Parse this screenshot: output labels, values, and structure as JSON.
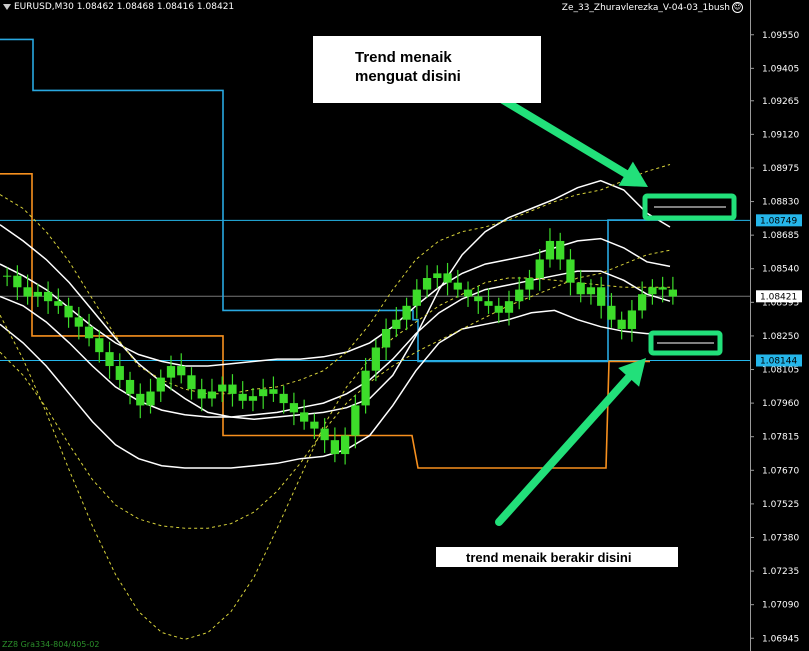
{
  "header": {
    "symbol_info": "EURUSD,M30  1.08462 1.08468 1.08416 1.08421",
    "indicator_title": "Ze_33_Zhuravlerezka_V-04-03_1bush"
  },
  "annotations": {
    "top": "Trend menaik\nmenguat disini",
    "bottom": "trend menaik berakir disini"
  },
  "footer": "ZZ8 Gra334-804/405-02",
  "chart_data": {
    "type": "line",
    "symbol": "EURUSD",
    "timeframe": "M30",
    "ylim": [
      1.0689,
      1.097
    ],
    "y_ticks": [
      "1.09550",
      "1.09405",
      "1.09265",
      "1.09120",
      "1.08975",
      "1.08830",
      "1.08685",
      "1.08540",
      "1.08395",
      "1.08250",
      "1.08105",
      "1.07960",
      "1.07815",
      "1.07670",
      "1.07525",
      "1.07380",
      "1.07235",
      "1.07090",
      "1.06945"
    ],
    "price_tags": [
      {
        "label": "1.08749",
        "value": 1.08749,
        "color": "#25b6ea"
      },
      {
        "label": "1.08421",
        "value": 1.08421,
        "color": "#ffffff"
      },
      {
        "label": "1.08144",
        "value": 1.08144,
        "color": "#25b6ea"
      }
    ],
    "hlines": [
      {
        "value": 1.08749,
        "color": "#25b6ea"
      },
      {
        "value": 1.08144,
        "color": "#25b6ea"
      },
      {
        "value": 1.08421,
        "color": "#777777"
      }
    ],
    "close_series": [
      1.0851,
      1.0846,
      1.0842,
      1.0844,
      1.084,
      1.0838,
      1.0833,
      1.0829,
      1.0824,
      1.0818,
      1.0812,
      1.0806,
      1.08,
      1.0795,
      1.0801,
      1.0807,
      1.0812,
      1.0808,
      1.0802,
      1.0798,
      1.0801,
      1.0804,
      1.08,
      1.0797,
      1.0799,
      1.0802,
      1.08,
      1.0796,
      1.0792,
      1.0788,
      1.0785,
      1.078,
      1.0774,
      1.0782,
      1.0795,
      1.081,
      1.082,
      1.0828,
      1.0832,
      1.0838,
      1.0845,
      1.085,
      1.0852,
      1.0848,
      1.0845,
      1.0842,
      1.084,
      1.0838,
      1.0835,
      1.084,
      1.0845,
      1.085,
      1.0858,
      1.0866,
      1.0858,
      1.0848,
      1.0843,
      1.0846,
      1.0838,
      1.0832,
      1.0828,
      1.0836,
      1.0843,
      1.0846,
      1.0845,
      1.0842
    ],
    "series": [
      {
        "name": "",
        "color": "#ffffff",
        "values": [
          1.0873,
          1.0866,
          1.0858,
          1.0848,
          1.0836,
          1.0824,
          1.0813,
          1.0805,
          1.0798,
          1.0792,
          1.079,
          1.0789,
          1.079,
          1.0791,
          1.0792,
          1.0794,
          1.0798,
          1.0808,
          1.0825,
          1.0845,
          1.086,
          1.087,
          1.0876,
          1.088,
          1.0884,
          1.0889,
          1.0892,
          1.0888,
          1.0878,
          1.0872
        ]
      },
      {
        "name": "",
        "color": "#ffffff",
        "values": [
          1.0856,
          1.0851,
          1.0845,
          1.0837,
          1.0829,
          1.0822,
          1.0817,
          1.0814,
          1.0812,
          1.0812,
          1.0813,
          1.0814,
          1.0815,
          1.0815,
          1.0816,
          1.0818,
          1.0822,
          1.0829,
          1.0838,
          1.0846,
          1.0852,
          1.0856,
          1.0858,
          1.086,
          1.0863,
          1.0866,
          1.0867,
          1.0863,
          1.0857,
          1.0855
        ]
      },
      {
        "name": "",
        "color": "#ffffff",
        "values": [
          1.0842,
          1.0838,
          1.0831,
          1.0822,
          1.0812,
          1.0803,
          1.0797,
          1.0793,
          1.0791,
          1.079,
          1.079,
          1.0791,
          1.0792,
          1.0794,
          1.0796,
          1.08,
          1.0806,
          1.0815,
          1.0826,
          1.0835,
          1.0841,
          1.0845,
          1.0847,
          1.0849,
          1.0851,
          1.0853,
          1.0853,
          1.0849,
          1.0843,
          1.084
        ]
      },
      {
        "name": "",
        "color": "#ffffff",
        "values": [
          1.083,
          1.0822,
          1.0812,
          1.08,
          1.0788,
          1.0778,
          1.0772,
          1.0769,
          1.0768,
          1.0768,
          1.0768,
          1.0769,
          1.077,
          1.0772,
          1.0773,
          1.0776,
          1.0782,
          1.0795,
          1.081,
          1.0822,
          1.0828,
          1.083,
          1.0832,
          1.0835,
          1.0836,
          1.0832,
          1.0829,
          1.0827,
          1.0826,
          1.0826
        ]
      },
      {
        "name": "",
        "color": "#d7d23a",
        "values": [
          1.0886,
          1.088,
          1.087,
          1.0857,
          1.0841,
          1.0825,
          1.0812,
          1.0806,
          1.0802,
          1.08,
          1.08,
          1.0802,
          1.0803,
          1.0806,
          1.081,
          1.0818,
          1.083,
          1.0845,
          1.0858,
          1.0866,
          1.087,
          1.0872,
          1.0875,
          1.0879,
          1.0883,
          1.0886,
          1.0888,
          1.0892,
          1.0896,
          1.0899
        ]
      },
      {
        "name": "",
        "color": "#d7d23a",
        "values": [
          1.0818,
          1.0808,
          1.0794,
          1.0778,
          1.0763,
          1.0752,
          1.0746,
          1.0743,
          1.0742,
          1.0742,
          1.0744,
          1.0749,
          1.0758,
          1.077,
          1.0784,
          1.0796,
          1.0805,
          1.0812,
          1.0818,
          1.0823,
          1.0828,
          1.0833,
          1.0838,
          1.0842,
          1.0846,
          1.085,
          1.0852,
          1.0856,
          1.086,
          1.0862
        ]
      },
      {
        "name": "",
        "color": "#d7d23a",
        "values": [
          1.0834,
          1.0815,
          1.0792,
          1.0767,
          1.0743,
          1.0722,
          1.0706,
          1.0697,
          1.0694,
          1.0697,
          1.0706,
          1.0721,
          1.0742,
          1.0764,
          1.0786,
          1.0803,
          1.0815,
          1.0824,
          1.0831,
          1.0838,
          1.0843,
          1.0848,
          1.085,
          1.085,
          1.0849,
          1.0848,
          1.0847,
          1.0846,
          1.0846,
          1.0846
        ]
      }
    ],
    "steps_blue": [
      [
        0,
        1.0953
      ],
      [
        33,
        1.0953
      ],
      [
        33,
        1.0931
      ],
      [
        223,
        1.0931
      ],
      [
        223,
        1.0836
      ],
      [
        413,
        1.0836
      ],
      [
        413,
        1.0832
      ],
      [
        418,
        1.0832
      ],
      [
        418,
        1.0814
      ],
      [
        608,
        1.0814
      ],
      [
        608,
        1.0875
      ],
      [
        650,
        1.0875
      ]
    ],
    "steps_orange": [
      [
        0,
        1.0895
      ],
      [
        32,
        1.0895
      ],
      [
        32,
        1.0825
      ],
      [
        223,
        1.0825
      ],
      [
        223,
        1.0782
      ],
      [
        412,
        1.0782
      ],
      [
        418,
        1.0768
      ],
      [
        606,
        1.0768
      ],
      [
        609,
        1.0814
      ],
      [
        650,
        1.0814
      ]
    ]
  }
}
